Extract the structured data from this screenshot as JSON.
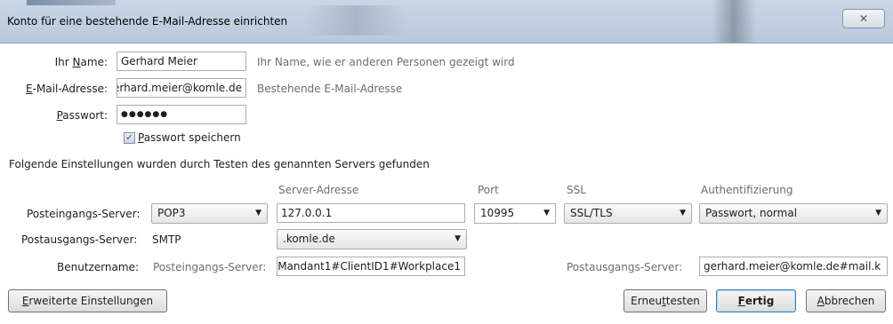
{
  "dialog": {
    "title": "Konto für eine bestehende E-Mail-Adresse einrichten",
    "close_label": "✕"
  },
  "identity": {
    "name_label_pre": "Ihr ",
    "name_label_u": "N",
    "name_label_post": "ame:",
    "name_value": "Gerhard Meier",
    "name_hint": "Ihr Name, wie er anderen Personen gezeigt wird",
    "email_label_u": "E",
    "email_label_post": "-Mail-Adresse:",
    "email_value": "gerhard.meier@komle.de",
    "email_hint": "Bestehende E-Mail-Adresse",
    "password_label_u": "P",
    "password_label_post": "asswort:",
    "password_value": "●●●●●●",
    "remember_checked": "✓",
    "remember_label_u": "P",
    "remember_label_post": "asswort speichern"
  },
  "found_text": "Folgende Einstellungen wurden durch Testen des genannten Servers gefunden",
  "columns": {
    "server": "Server-Adresse",
    "port": "Port",
    "ssl": "SSL",
    "auth": "Authentifizierung"
  },
  "incoming": {
    "label": "Posteingangs-Server:",
    "protocol": "POP3",
    "server": "127.0.0.1",
    "port": "10995",
    "ssl": "SSL/TLS",
    "auth": "Passwort, normal"
  },
  "outgoing": {
    "label": "Postausgangs-Server:",
    "protocol": "SMTP",
    "server": ".komle.de"
  },
  "username": {
    "label": "Benutzername:",
    "incoming_label": "Posteingangs-Server:",
    "incoming_value": "Mandant1#ClientID1#Workplace1",
    "outgoing_label": "Postausgangs-Server:",
    "outgoing_value": "gerhard.meier@komle.de#mail.k"
  },
  "buttons": {
    "advanced_u": "E",
    "advanced_post": "rweiterte Einstellungen",
    "retest_pre": "Erneu",
    "retest_u": "t",
    "retest_post": " testen",
    "done_u": "F",
    "done_post": "ertig",
    "cancel_u": "A",
    "cancel_post": "bbrechen"
  }
}
